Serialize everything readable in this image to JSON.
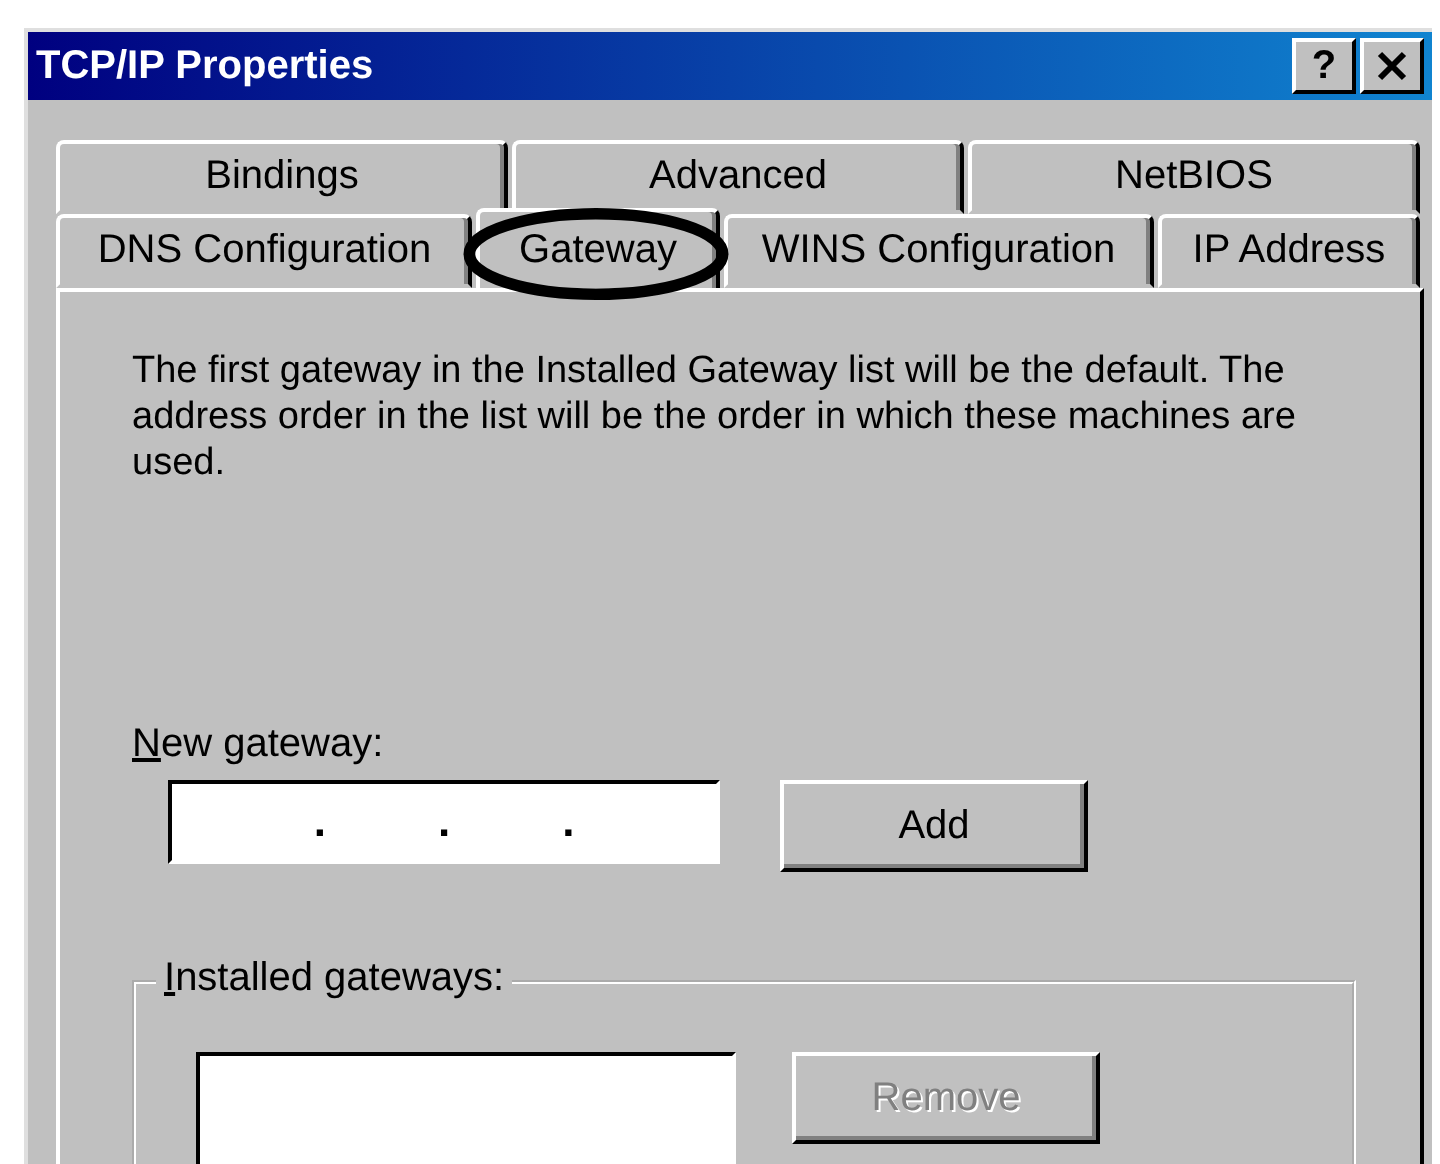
{
  "window": {
    "title": "TCP/IP Properties",
    "help_button": "?"
  },
  "tab_rows": [
    [
      {
        "label": "Bindings",
        "selected": false,
        "circled": false
      },
      {
        "label": "Advanced",
        "selected": false,
        "circled": false
      },
      {
        "label": "NetBIOS",
        "selected": false,
        "circled": false
      }
    ],
    [
      {
        "label": "DNS Configuration",
        "selected": false,
        "circled": false
      },
      {
        "label": "Gateway",
        "selected": true,
        "circled": true
      },
      {
        "label": "WINS Configuration",
        "selected": false,
        "circled": false
      },
      {
        "label": "IP Address",
        "selected": false,
        "circled": false
      }
    ]
  ],
  "description": "The first gateway in the Installed Gateway list will be the default. The address order in the list will be the order in which these machines are used.",
  "new_gateway": {
    "label": "New gateway:",
    "separators": [
      ".",
      ".",
      "."
    ]
  },
  "add_button": {
    "label": "Add",
    "disabled": false
  },
  "installed_gateways": {
    "label": "Installed gateways:"
  },
  "remove_button": {
    "label": "Remove",
    "disabled": true
  }
}
